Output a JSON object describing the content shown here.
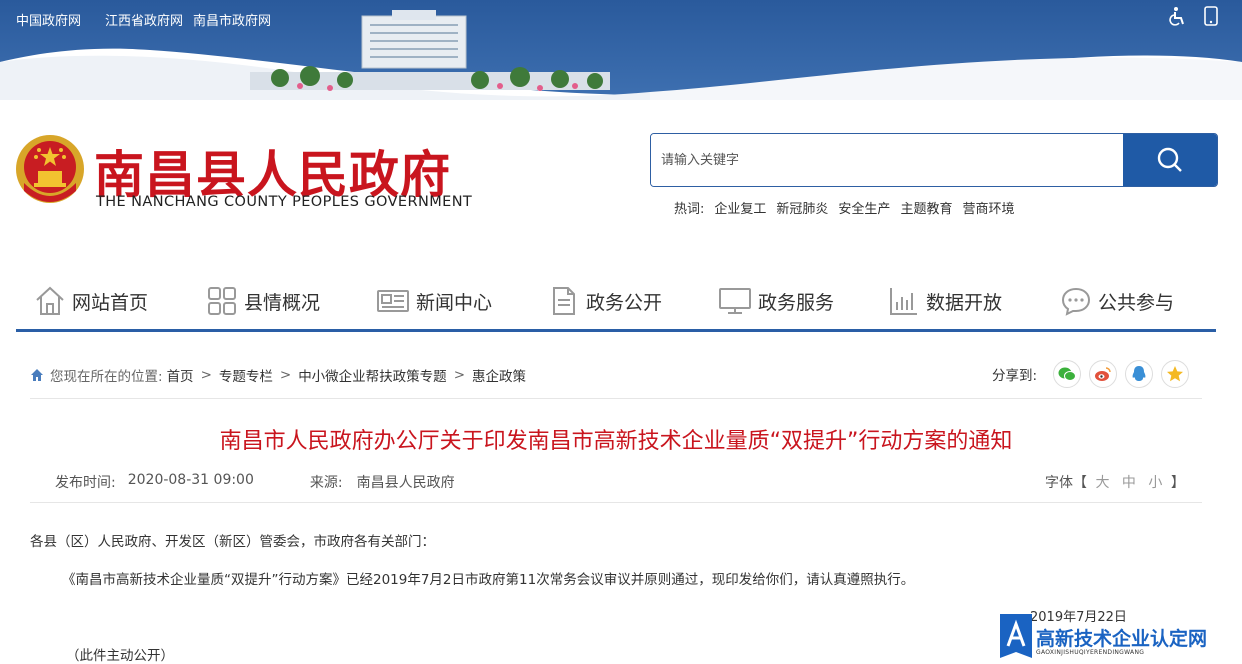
{
  "top_links": [
    "中国政府网",
    "江西省政府网",
    "南昌市政府网"
  ],
  "top_icons": [
    "accessibility-icon",
    "mobile-icon"
  ],
  "logo": {
    "cn": "南昌县人民政府",
    "en": "THE NANCHANG COUNTY PEOPLES GOVERNMENT"
  },
  "search": {
    "placeholder": "请输入关键字"
  },
  "hot": {
    "label": "热词:",
    "words": [
      "企业复工",
      "新冠肺炎",
      "安全生产",
      "主题教育",
      "营商环境"
    ]
  },
  "nav": [
    {
      "label": "网站首页",
      "icon": "home-icon"
    },
    {
      "label": "县情概况",
      "icon": "grid-icon"
    },
    {
      "label": "新闻中心",
      "icon": "news-icon"
    },
    {
      "label": "政务公开",
      "icon": "document-icon"
    },
    {
      "label": "政务服务",
      "icon": "monitor-icon"
    },
    {
      "label": "数据开放",
      "icon": "chart-icon"
    },
    {
      "label": "公共参与",
      "icon": "chat-icon"
    }
  ],
  "breadcrumb": {
    "prefix": "您现在所在的位置:",
    "items": [
      "首页",
      "专题专栏",
      "中小微企业帮扶政策专题",
      "惠企政策"
    ]
  },
  "share": {
    "label": "分享到:",
    "targets": [
      "wechat-icon",
      "weibo-icon",
      "qq-icon",
      "qzone-icon"
    ]
  },
  "article": {
    "title": "南昌市人民政府办公厅关于印发南昌市高新技术企业量质“双提升”行动方案的通知",
    "publish_label": "发布时间:",
    "publish_time": "2020-08-31 09:00",
    "source_label": "来源:",
    "source": "南昌县人民政府",
    "font_label": "字体【",
    "font_sizes": [
      "大",
      "中",
      "小"
    ],
    "font_end": "】",
    "para1": "各县（区）人民政府、开发区（新区）管委会，市政府各有关部门：",
    "para2": "《南昌市高新技术企业量质“双提升”行动方案》已经2019年7月2日市政府第11次常务会议审议并原则通过，现印发给你们，请认真遵照执行。",
    "date": "2019年7月22日",
    "para3": "（此件主动公开）"
  },
  "watermark": {
    "title": "高新技术企业认定网",
    "sub": "GAOXINJISHUQIYERENDINGWANG"
  },
  "colors": {
    "brand_red": "#c9151e",
    "brand_blue": "#1f5aa6"
  }
}
